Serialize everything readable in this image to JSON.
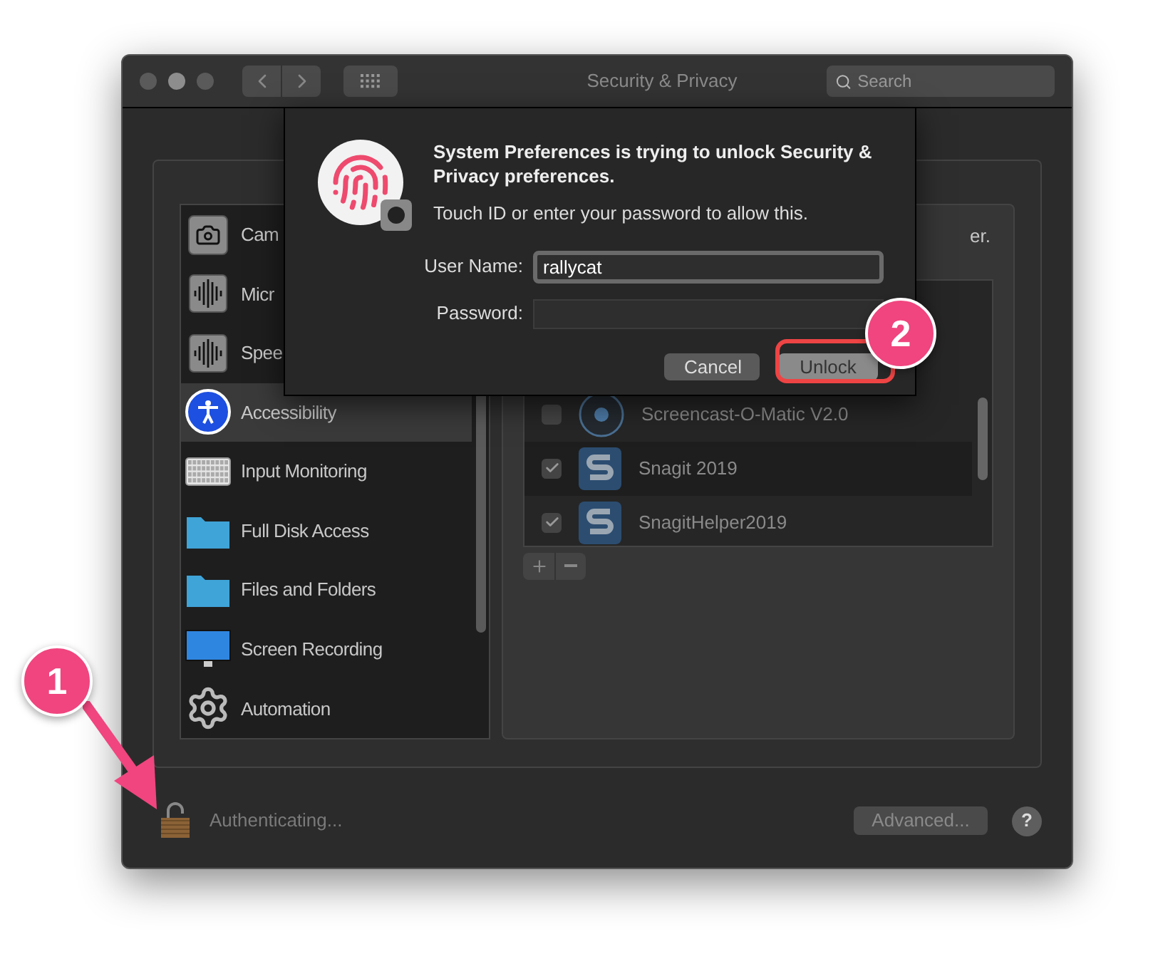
{
  "window": {
    "title": "Security & Privacy",
    "search": {
      "placeholder": "Search"
    }
  },
  "sidebar": {
    "items": [
      {
        "label": "Cam",
        "selected": false
      },
      {
        "label": "Micr",
        "selected": false
      },
      {
        "label": "Spee",
        "selected": false
      },
      {
        "label": "Accessibility",
        "selected": true
      },
      {
        "label": "Input Monitoring",
        "selected": false
      },
      {
        "label": "Full Disk Access",
        "selected": false
      },
      {
        "label": "Files and Folders",
        "selected": false
      },
      {
        "label": "Screen Recording",
        "selected": false
      },
      {
        "label": "Automation",
        "selected": false
      }
    ]
  },
  "right_panel": {
    "text": "er.",
    "apps": [
      {
        "name": "Screencast-O-Matic V2.0",
        "checked": false,
        "kind": "disc"
      },
      {
        "name": "Snagit 2019",
        "checked": true,
        "kind": "snagit"
      },
      {
        "name": "SnagitHelper2019",
        "checked": true,
        "kind": "snagit"
      }
    ]
  },
  "footer": {
    "lock_status": "Authenticating...",
    "advanced_button": "Advanced...",
    "help_button": "?"
  },
  "dialog": {
    "title": "System Preferences is trying to unlock Security & Privacy preferences.",
    "message": "Touch ID or enter your password to allow this.",
    "user_name_label": "User Name:",
    "user_name": "rallycat",
    "password_label": "Password:",
    "buttons": [
      {
        "label": "Cancel",
        "highlighted": false
      },
      {
        "label": "Unlock",
        "highlighted": true
      }
    ]
  },
  "callouts": [
    {
      "number": "1"
    },
    {
      "number": "2"
    }
  ]
}
